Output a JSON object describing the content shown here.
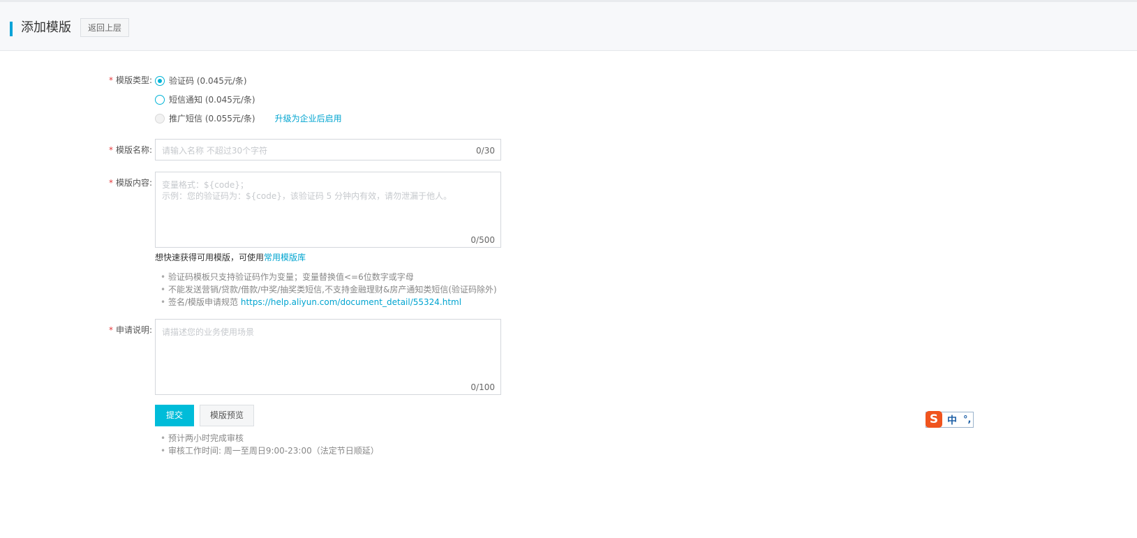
{
  "header": {
    "title": "添加模版",
    "back_label": "返回上层"
  },
  "form": {
    "type_label": "模版类型:",
    "type_options": [
      {
        "label": "验证码 (0.045元/条)",
        "checked": true,
        "disabled": false
      },
      {
        "label": "短信通知 (0.045元/条)",
        "checked": false,
        "disabled": false
      },
      {
        "label": "推广短信 (0.055元/条)",
        "checked": false,
        "disabled": true
      }
    ],
    "upgrade_link": "升级为企业后启用",
    "name_label": "模版名称:",
    "name_placeholder": "请输入名称 不超过30个字符",
    "name_counter": "0/30",
    "content_label": "模版内容:",
    "content_placeholder_line1": "变量格式：${code}；",
    "content_placeholder_line2": "示例：您的验证码为：${code}，该验证码 5 分钟内有效，请勿泄漏于他人。",
    "content_counter": "0/500",
    "library_hint": "想快速获得可用模版，可使用",
    "library_link": "常用模版库",
    "tips": [
      "验证码模板只支持验证码作为变量；变量替换值<=6位数字或字母",
      "不能发送营销/贷款/借款/中奖/抽奖类短信,不支持金融理财&房产通知类短信(验证码除外)"
    ],
    "tip_rule_prefix": "签名/模版申请规范 ",
    "tip_rule_link": "https://help.aliyun.com/document_detail/55324.html",
    "desc_label": "申请说明:",
    "desc_placeholder": "请描述您的业务使用场景",
    "desc_counter": "0/100",
    "submit_label": "提交",
    "preview_label": "模版预览",
    "notes": [
      "预计两小时完成审核",
      "审核工作时间: 周一至周日9:00-23:00（法定节日顺延）"
    ]
  },
  "ime": {
    "logo": "S",
    "mode": "中",
    "punct": "°,"
  }
}
